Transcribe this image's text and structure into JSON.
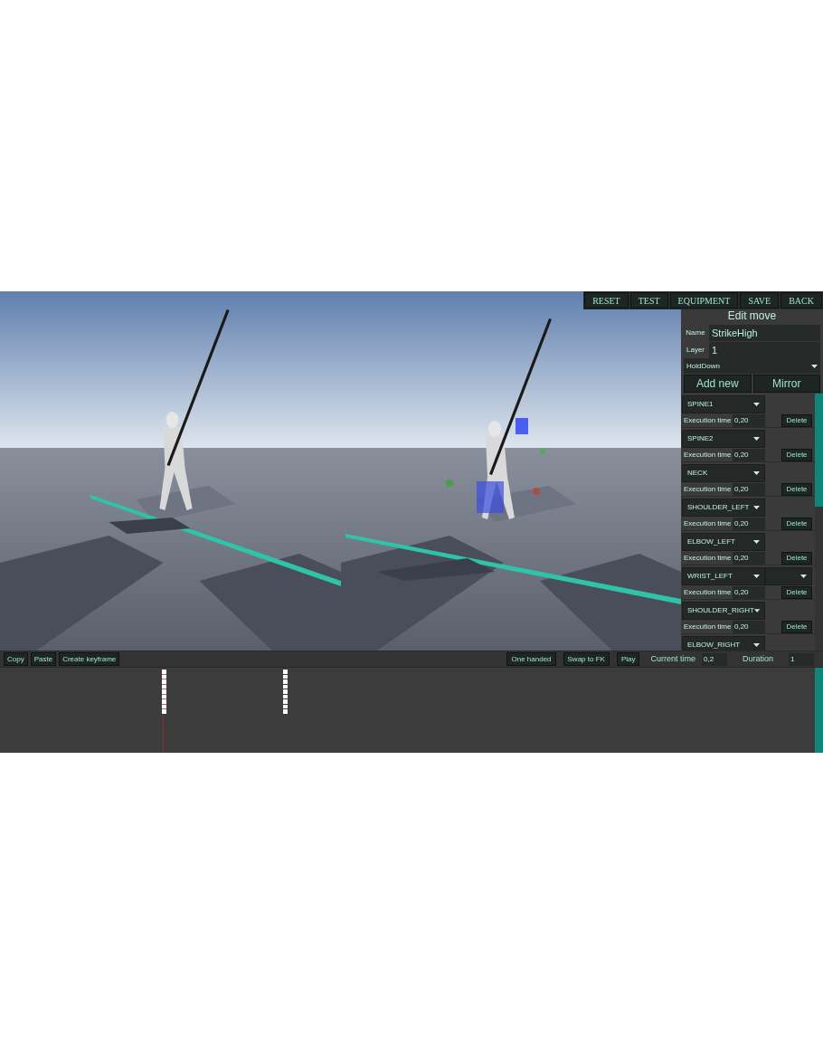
{
  "toolbar": [
    "RESET",
    "TEST",
    "EQUIPMENT",
    "SAVE",
    "BACK"
  ],
  "viewports": [
    {
      "kind": "picture",
      "gizmos": false
    },
    {
      "kind": "picture",
      "gizmos": true
    }
  ],
  "editor": {
    "title": "Edit move",
    "name_label": "Name",
    "name_value": "StrikeHigh",
    "layer_label": "Layer",
    "layer_value": "1",
    "mode_dropdown": "HoldDown",
    "buttons": [
      "Add new",
      "Mirror"
    ],
    "bones": [
      {
        "bone": "SPINE1",
        "time_label": "Execution time",
        "time": "0,20",
        "delete": "Delete",
        "extra_dropdown": false
      },
      {
        "bone": "SPINE2",
        "time_label": "Execution time",
        "time": "0,20",
        "delete": "Delete",
        "extra_dropdown": false
      },
      {
        "bone": "NECK",
        "time_label": "Execution time",
        "time": "0,20",
        "delete": "Delete",
        "extra_dropdown": false
      },
      {
        "bone": "SHOULDER_LEFT",
        "time_label": "Execution time",
        "time": "0,20",
        "delete": "Delete",
        "extra_dropdown": false
      },
      {
        "bone": "ELBOW_LEFT",
        "time_label": "Execution time",
        "time": "0,20",
        "delete": "Delete",
        "extra_dropdown": false
      },
      {
        "bone": "WRIST_LEFT",
        "time_label": "Execution time",
        "time": "0,20",
        "delete": "Delete",
        "extra_dropdown": true
      },
      {
        "bone": "SHOULDER_RIGHT",
        "time_label": "Execution time",
        "time": "0,20",
        "delete": "Delete",
        "extra_dropdown": false
      },
      {
        "bone": "ELBOW_RIGHT",
        "extra_dropdown": false
      }
    ]
  },
  "bottom_bar": {
    "left_buttons": [
      "Copy",
      "Paste",
      "Create keyframe"
    ],
    "right_buttons": [
      "One handed",
      "Swap to FK",
      "Play"
    ],
    "current_time_label": "Current time",
    "current_time": "0,2",
    "duration_label": "Duration",
    "duration": "1"
  },
  "timeline": {
    "playhead": {
      "level": 0.2
    },
    "keyframes": [
      {
        "selected": true
      },
      {
        "selected": false
      }
    ]
  }
}
